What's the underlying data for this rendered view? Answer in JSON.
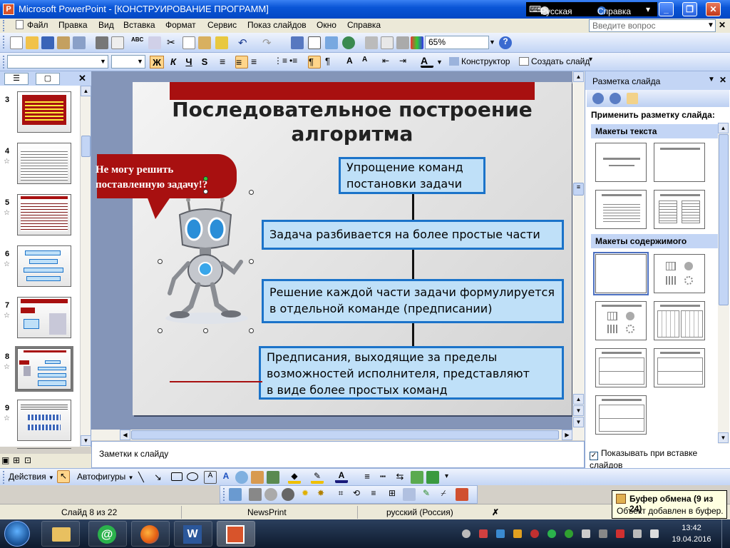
{
  "window": {
    "title": "Microsoft PowerPoint - [КОНСТРУИРОВАНИЕ ПРОГРАММ]",
    "language": "Русская",
    "help": "Справка"
  },
  "menu": {
    "items": [
      "Файл",
      "Правка",
      "Вид",
      "Вставка",
      "Формат",
      "Сервис",
      "Показ слайдов",
      "Окно",
      "Справка"
    ],
    "help_placeholder": "Введите вопрос"
  },
  "toolbar": {
    "zoom": "65%",
    "format_buttons": [
      "Ж",
      "К",
      "Ч",
      "S"
    ],
    "designer_label": "Конструктор",
    "new_slide_label": "Создать слайд"
  },
  "slides_pane": {
    "thumbnails": [
      {
        "number": "3",
        "star": false,
        "selected": false
      },
      {
        "number": "4",
        "star": true,
        "selected": false
      },
      {
        "number": "5",
        "star": true,
        "selected": false
      },
      {
        "number": "6",
        "star": true,
        "selected": false
      },
      {
        "number": "7",
        "star": true,
        "selected": false
      },
      {
        "number": "8",
        "star": true,
        "selected": true
      },
      {
        "number": "9",
        "star": true,
        "selected": false
      }
    ]
  },
  "slide": {
    "title_line1": "Последовательное построение",
    "title_line2": "алгоритма",
    "bubble_line1": "Не могу решить",
    "bubble_line2": "поставленную задачу!?",
    "boxes": [
      {
        "line1": "Упрощение команд",
        "line2": "постановки задачи"
      },
      {
        "line1": "Задача разбивается на более простые части"
      },
      {
        "line1": "Решение каждой части задачи формулируется",
        "line2": "в отдельной команде (предписании)"
      },
      {
        "line1": "Предписания, выходящие за пределы",
        "line2": "возможностей исполнителя, представляют",
        "line3": "в виде более простых команд"
      }
    ]
  },
  "notes": {
    "label": "Заметки к слайду"
  },
  "task_pane": {
    "title": "Разметка слайда",
    "apply_label": "Применить разметку слайда:",
    "text_layouts": "Макеты текста",
    "content_layouts": "Макеты содержимого",
    "show_on_insert": "Показывать при вставке слайдов"
  },
  "drawing": {
    "actions": "Действия",
    "autoshapes": "Автофигуры"
  },
  "status": {
    "slide_info": "Слайд 8 из 22",
    "design": "NewsPrint",
    "language": "русский (Россия)"
  },
  "clipboard": {
    "title": "Буфер обмена (9 из 24)",
    "message": "Объект добавлен в буфер."
  },
  "clock": {
    "time": "13:42",
    "date": "19.04.2016"
  },
  "colors": {
    "accent_red": "#a81010",
    "box_border": "#1b73c9",
    "box_fill": "#bfe0f8",
    "titlebar": "#0a55d6"
  }
}
